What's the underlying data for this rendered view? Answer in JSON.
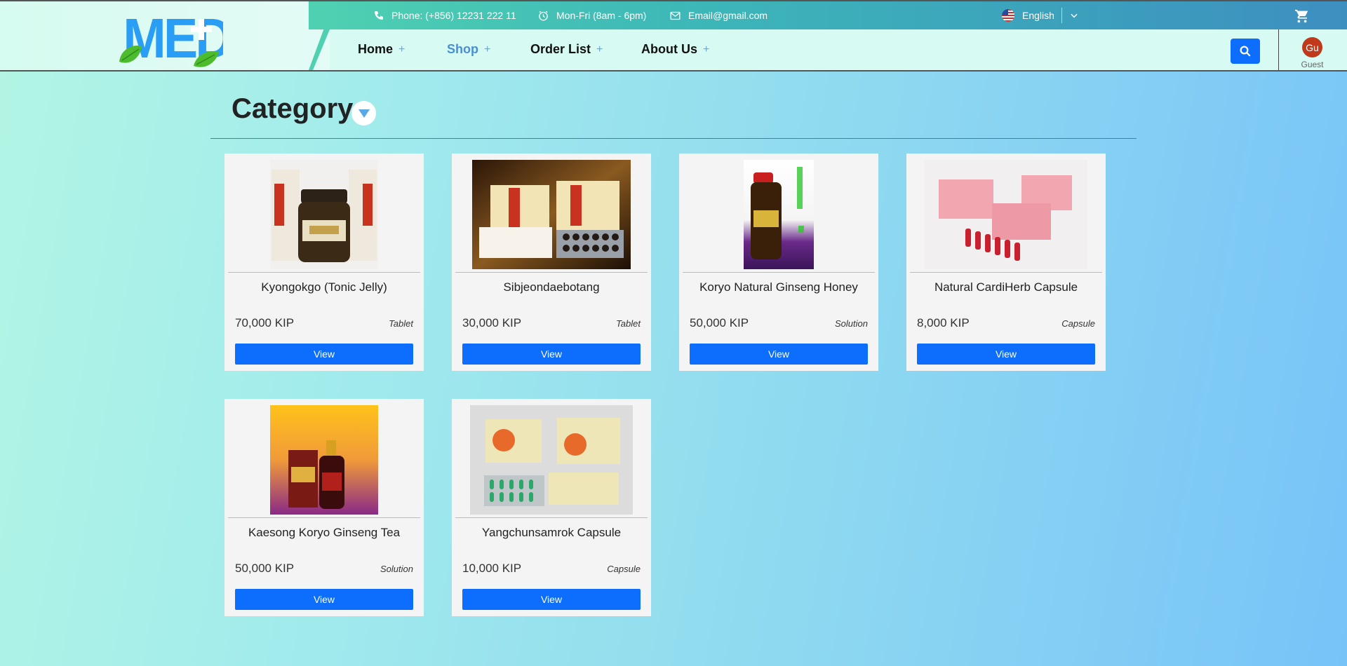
{
  "brand": {
    "logo_text": "MED"
  },
  "topbar": {
    "phone": "Phone: (+856) 12231 222 11",
    "hours": "Mon-Fri (8am - 6pm)",
    "email": "Email@gmail.com",
    "language": "English"
  },
  "nav": {
    "items": [
      {
        "label": "Home",
        "plus": "+"
      },
      {
        "label": "Shop",
        "plus": "+"
      },
      {
        "label": "Order List",
        "plus": "+"
      },
      {
        "label": "About Us",
        "plus": "+"
      }
    ],
    "active": "Shop"
  },
  "user": {
    "initials": "Gu",
    "label": "Guest"
  },
  "category": {
    "title": "Category"
  },
  "products": [
    {
      "name": "Kyongokgo (Tonic Jelly)",
      "price": "70,000 KIP",
      "type": "Tablet",
      "button": "View"
    },
    {
      "name": "Sibjeondaebotang",
      "price": "30,000 KIP",
      "type": "Tablet",
      "button": "View"
    },
    {
      "name": "Koryo Natural Ginseng Honey",
      "price": "50,000 KIP",
      "type": "Solution",
      "button": "View"
    },
    {
      "name": "Natural CardiHerb Capsule",
      "price": "8,000 KIP",
      "type": "Capsule",
      "button": "View"
    },
    {
      "name": "Kaesong Koryo Ginseng Tea",
      "price": "50,000 KIP",
      "type": "Solution",
      "button": "View"
    },
    {
      "name": "Yangchunsamrok Capsule",
      "price": "10,000 KIP",
      "type": "Capsule",
      "button": "View"
    }
  ],
  "colors": {
    "primary": "#0d6efd",
    "nav_active": "#4a8fd1",
    "avatar": "#c0391b",
    "logo": "#2a9df4",
    "leaf": "#4cbb2e"
  },
  "icons": {
    "phone": "phone-icon",
    "clock": "clock-icon",
    "email": "mail-icon",
    "flag": "us-flag-icon",
    "chevron": "chevron-down-icon",
    "cart": "cart-icon",
    "search": "search-icon",
    "category_toggle": "caret-down-icon"
  }
}
